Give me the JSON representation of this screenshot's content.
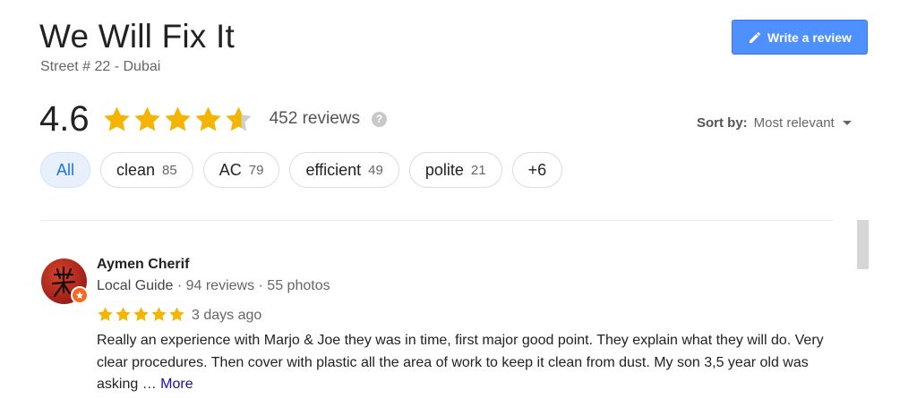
{
  "business": {
    "name": "We Will Fix It",
    "address": "Street # 22 - Dubai"
  },
  "write_review": {
    "label": "Write a review",
    "icon": "pencil-icon"
  },
  "summary": {
    "rating": "4.6",
    "stars_value": 4.6,
    "stars_max": 5,
    "reviews_count": "452 reviews",
    "help_icon": "?"
  },
  "sort": {
    "label": "Sort by:",
    "value": "Most relevant"
  },
  "filters": [
    {
      "label": "All",
      "count": "",
      "active": true
    },
    {
      "label": "clean",
      "count": "85",
      "active": false
    },
    {
      "label": "AC",
      "count": "79",
      "active": false
    },
    {
      "label": "efficient",
      "count": "49",
      "active": false
    },
    {
      "label": "polite",
      "count": "21",
      "active": false
    },
    {
      "label": "+6",
      "count": "",
      "active": false
    }
  ],
  "review": {
    "author": "Aymen Cherif",
    "meta_guide": "Local Guide",
    "meta_rest": " · 94 reviews · 55 photos",
    "stars_value": 5,
    "date": "3 days ago",
    "text": "Really an experience with Marjo & Joe they was in time, first major good point. They explain what they will do. Very clear procedures. Then cover with plastic all the area of work to keep it clean from dust. My son 3,5 year old was asking … ",
    "more_label": "More"
  },
  "colors": {
    "star_fill": "#f4b400",
    "star_empty": "#cfcfcf",
    "button_blue": "#4d90fe",
    "link_blue": "#1a0dab",
    "chip_active_bg": "#e8f0fe",
    "badge_orange": "#f46a24"
  }
}
